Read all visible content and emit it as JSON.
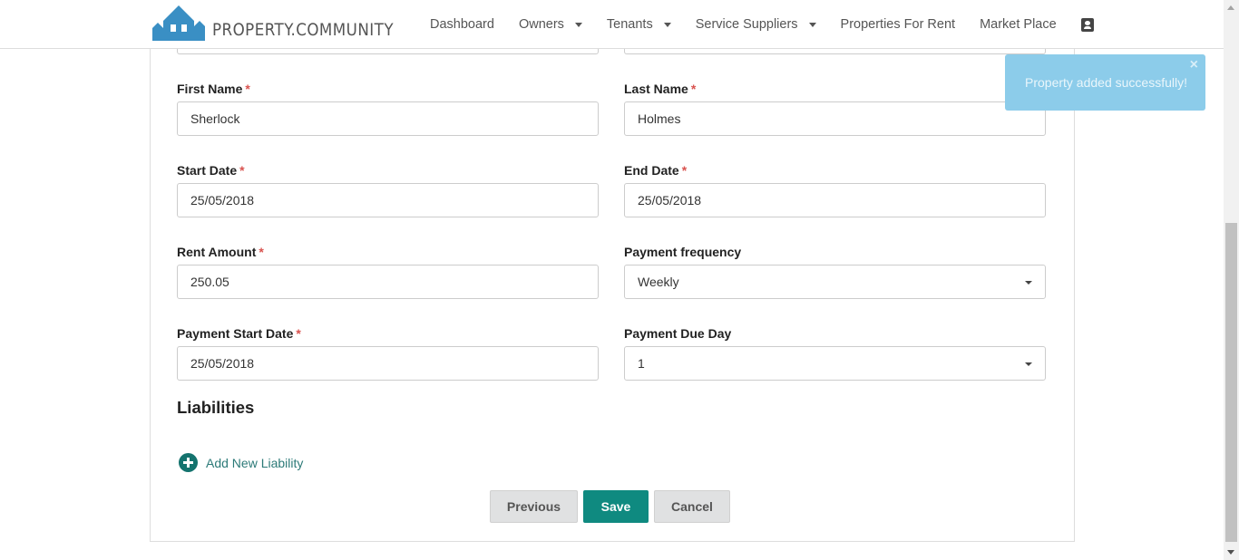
{
  "brand": {
    "name": "PROPERTY.COMMUNITY",
    "color": "#3a8fc4"
  },
  "nav": {
    "items": [
      {
        "label": "Dashboard",
        "dropdown": false
      },
      {
        "label": "Owners",
        "dropdown": true
      },
      {
        "label": "Tenants",
        "dropdown": true
      },
      {
        "label": "Service Suppliers",
        "dropdown": true
      },
      {
        "label": "Properties For Rent",
        "dropdown": false
      },
      {
        "label": "Market Place",
        "dropdown": false
      }
    ],
    "account_icon": "contact-card-icon"
  },
  "form": {
    "first_name": {
      "label": "First Name",
      "required": "*",
      "value": "Sherlock"
    },
    "last_name": {
      "label": "Last Name",
      "required": "*",
      "value": "Holmes"
    },
    "start_date": {
      "label": "Start Date",
      "required": "*",
      "value": "25/05/2018"
    },
    "end_date": {
      "label": "End Date",
      "required": "*",
      "value": "25/05/2018"
    },
    "rent_amount": {
      "label": "Rent Amount",
      "required": "*",
      "value": "250.05"
    },
    "payment_frequency": {
      "label": "Payment frequency",
      "value": "Weekly"
    },
    "payment_start_date": {
      "label": "Payment Start Date",
      "required": "*",
      "value": "25/05/2018"
    },
    "payment_due_day": {
      "label": "Payment Due Day",
      "value": "1"
    }
  },
  "liabilities": {
    "title": "Liabilities",
    "add_label": "Add New Liability"
  },
  "actions": {
    "previous": "Previous",
    "save": "Save",
    "cancel": "Cancel"
  },
  "toast": {
    "message": "Property added successfully!",
    "close": "×"
  },
  "colors": {
    "accent": "#0f8a80",
    "required": "#d9534f",
    "toast_bg": "#8cccea"
  }
}
